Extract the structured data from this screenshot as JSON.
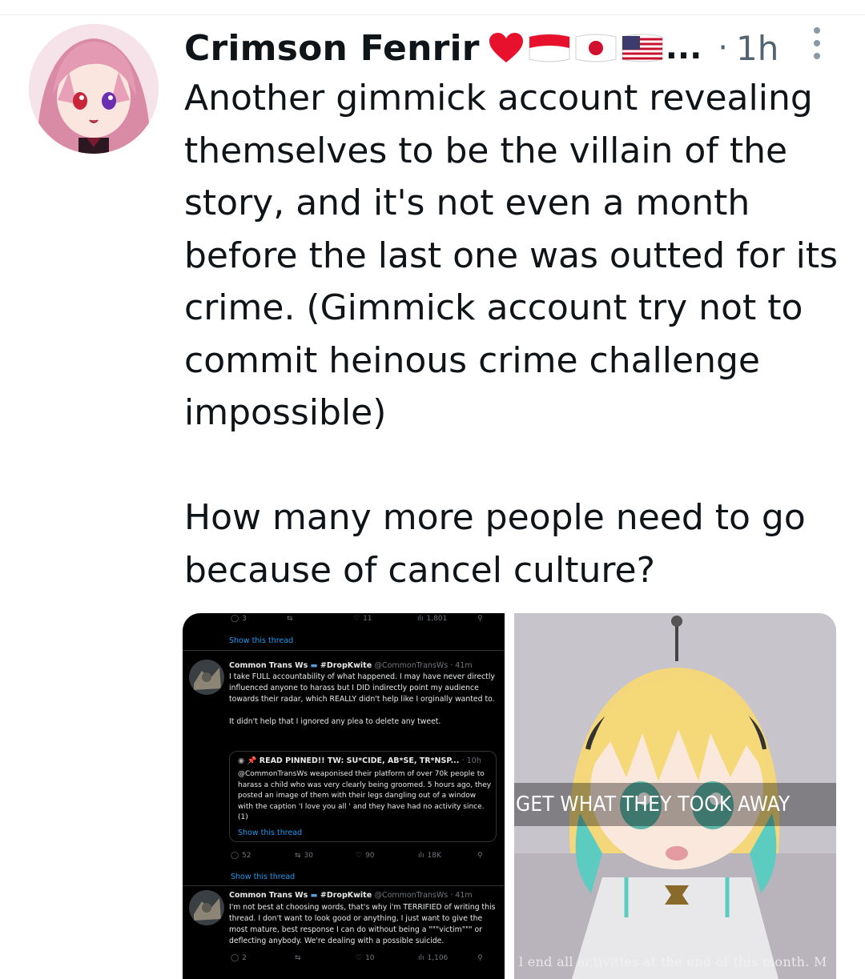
{
  "tweet": {
    "author_name": "Crimson Fenrir",
    "name_emoji": [
      "heart-emoji",
      "flag-indonesia-emoji",
      "flag-japan-emoji",
      "flag-usa-emoji"
    ],
    "name_truncation": "...",
    "separator": "·",
    "time": "1h",
    "text": "Another gimmick account revealing themselves to be the villain of the story, and it's not even a month before the last one was outted for its crime. (Gimmick account try not to commit heinous crime challenge impossible)\n\nHow many more people need to go because of cancel culture?"
  },
  "media_left": {
    "top_metrics": {
      "replies": "3",
      "likes": "11",
      "views": "1,801"
    },
    "show_thread_1": "Show this thread",
    "post1": {
      "name": "Common Trans Ws",
      "hashtag": "#DropKwite",
      "handle_time": "@CommonTransWs · 41m",
      "text": "I take FULL accountability of what happened. I may have never directly influenced anyone to harass but I DID indirectly point my audience towards their radar, which REALLY didn't help like I orginally wanted to.\n\nIt didn't help that I ignored any plea to delete any tweet."
    },
    "quote": {
      "title": "READ PINNED!! TW: SU*CIDE, AB*SE, TR*NSP...",
      "time": "· 10h",
      "text": "@CommonTransWs weaponised their platform of over 70k people to harass a child who was very clearly being groomed. 5 hours ago, they posted an image of them with their legs dangling out of a window with the caption 'I love you all ' and they have had no activity since. (1)",
      "show_thread": "Show this thread"
    },
    "mid_metrics": {
      "replies": "52",
      "retweets": "30",
      "likes": "90",
      "views": "18K"
    },
    "show_thread_2": "Show this thread",
    "post2": {
      "name": "Common Trans Ws",
      "hashtag": "#DropKwite",
      "handle_time": "@CommonTransWs · 41m",
      "text": "I'm not best at choosing words, that's why i'm TERRIFIED of writing this thread. I don't want to look good or anything, I just want to give the most mature, best response I can do without being a \"\"\"victim\"\"\" or deflecting anybody. We're dealing with a possible suicide."
    },
    "bottom_metrics": {
      "replies": "2",
      "likes": "10",
      "views": "1,106"
    }
  },
  "media_right": {
    "subtitle": "GET WHAT THEY TOOK AWAY",
    "bottom_caption": "l end all activities at the end of this month. M"
  },
  "colors": {
    "link": "#1d9bf0",
    "heart": "#e8112d",
    "muted": "#536471"
  }
}
